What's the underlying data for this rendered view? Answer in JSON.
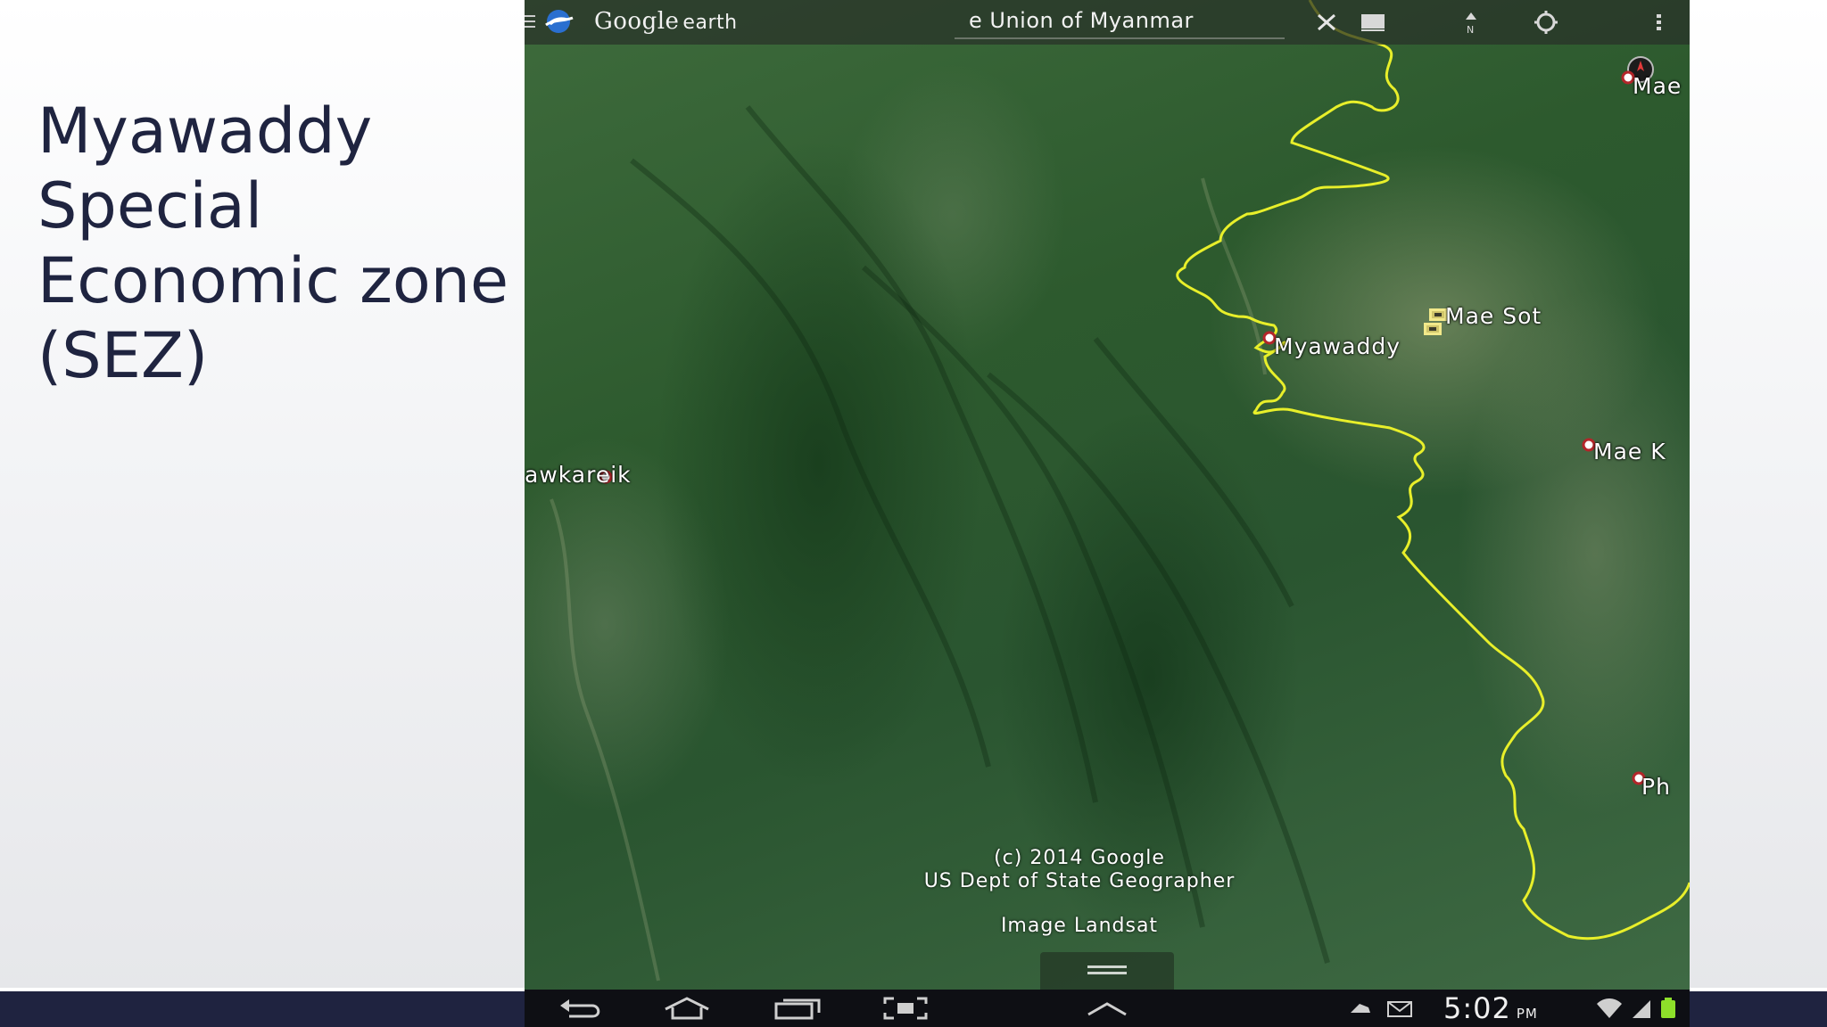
{
  "slide": {
    "title": "Myawaddy\nSpecial\nEconomic zone\n(SEZ)"
  },
  "app": {
    "brand_logo": "Google",
    "brand_suffix": "earth",
    "search_query": "e Union of Myanmar"
  },
  "icons": {
    "menu": "menu-icon",
    "globe": "google-earth-globe-icon",
    "clear": "clear-search-icon",
    "layers": "layers-icon",
    "north": "north-arrow-icon",
    "location": "my-location-icon",
    "overflow": "more-options-icon"
  },
  "map": {
    "places": [
      {
        "name": "Mae",
        "kind": "pin"
      },
      {
        "name": "Mae Sot",
        "kind": "square"
      },
      {
        "name": "Myawaddy",
        "kind": "pin"
      },
      {
        "name": "Mae K",
        "kind": "pin"
      },
      {
        "name": "awkareik",
        "kind": "pin"
      },
      {
        "name": "Ph",
        "kind": "pin"
      }
    ],
    "border_color": "#e8ef2a",
    "copyright_lines": [
      "(c) 2014 Google",
      "US Dept of State Geographer",
      "Image Landsat"
    ]
  },
  "status_bar": {
    "time": "5:02",
    "ampm": "PM"
  },
  "colors": {
    "title_text": "#1f2440",
    "footer_bar": "#1f2340",
    "nav_bar": "#0e0f14"
  }
}
